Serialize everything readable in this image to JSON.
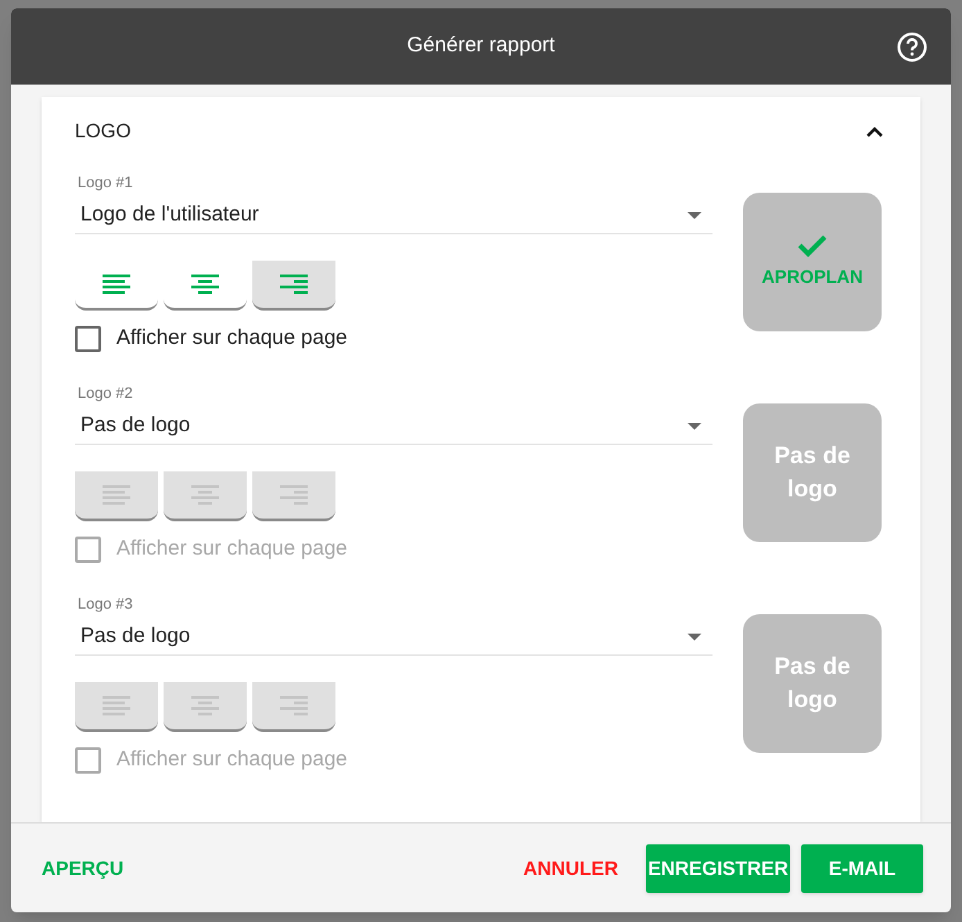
{
  "dialog": {
    "title": "Générer rapport",
    "section": {
      "title": "LOGO",
      "expanded": true,
      "logos": [
        {
          "label": "Logo #1",
          "value": "Logo de l'utilisateur",
          "disabled": false,
          "alignments": [
            {
              "kind": "left",
              "selected": false
            },
            {
              "kind": "center",
              "selected": false
            },
            {
              "kind": "right",
              "selected": true
            }
          ],
          "checkbox": {
            "label": "Afficher sur chaque page",
            "checked": false
          },
          "preview": {
            "kind": "image",
            "text": "APROPLAN"
          }
        },
        {
          "label": "Logo #2",
          "value": "Pas de logo",
          "disabled": true,
          "alignments": [
            {
              "kind": "left",
              "selected": false
            },
            {
              "kind": "center",
              "selected": false
            },
            {
              "kind": "right",
              "selected": false
            }
          ],
          "checkbox": {
            "label": "Afficher sur chaque page",
            "checked": false
          },
          "preview": {
            "kind": "none",
            "text": "Pas de logo"
          }
        },
        {
          "label": "Logo #3",
          "value": "Pas de logo",
          "disabled": true,
          "alignments": [
            {
              "kind": "left",
              "selected": false
            },
            {
              "kind": "center",
              "selected": false
            },
            {
              "kind": "right",
              "selected": false
            }
          ],
          "checkbox": {
            "label": "Afficher sur chaque page",
            "checked": false
          },
          "preview": {
            "kind": "none",
            "text": "Pas de logo"
          }
        }
      ]
    },
    "footer": {
      "preview_button": "APERÇU",
      "cancel_button": "ANNULER",
      "save_button": "ENREGISTRER",
      "email_button": "E-MAIL"
    }
  }
}
